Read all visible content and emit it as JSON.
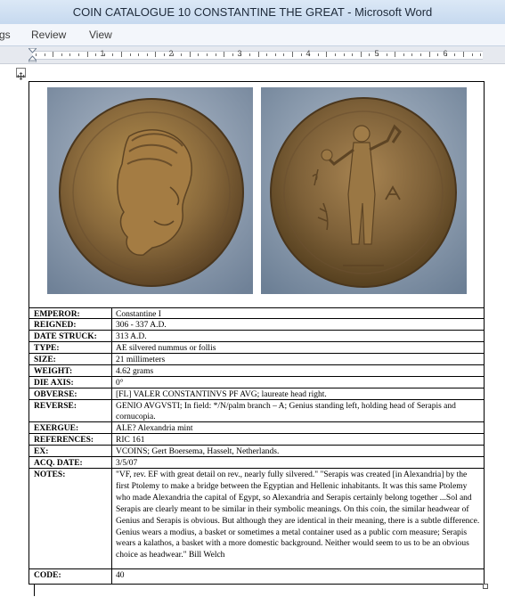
{
  "window": {
    "title": "COIN CATALOGUE 10 CONSTANTINE THE GREAT  -  Microsoft Word"
  },
  "ribbon": {
    "tabs": [
      "gs",
      "Review",
      "View"
    ]
  },
  "ruler": {
    "numbers": [
      "1",
      "2",
      "3",
      "4",
      "5",
      "6"
    ]
  },
  "table": {
    "rows": [
      {
        "label": "EMPEROR:",
        "value": "Constantine I"
      },
      {
        "label": "REIGNED:",
        "value": "306 - 337 A.D."
      },
      {
        "label": "DATE STRUCK:",
        "value": "313 A.D."
      },
      {
        "label": "TYPE:",
        "value": "AE silvered nummus or follis"
      },
      {
        "label": "SIZE:",
        "value": "21 millimeters"
      },
      {
        "label": "WEIGHT:",
        "value": "4.62 grams"
      },
      {
        "label": "DIE AXIS:",
        "value": "0°"
      },
      {
        "label": "OBVERSE:",
        "value": "[FL] VALER CONSTANTINVS PF AVG; laureate head right."
      },
      {
        "label": "REVERSE:",
        "value": "GENIO AVGVSTI; In field: */N/palm branch – A; Genius standing left, holding head of Serapis and cornucopia."
      },
      {
        "label": "EXERGUE:",
        "value": "ALE? Alexandria mint"
      },
      {
        "label": "REFERENCES:",
        "value": "RIC 161"
      },
      {
        "label": "EX:",
        "value": "VCOINS; Gert Boersema, Hasselt, Netherlands."
      },
      {
        "label": "ACQ. DATE:",
        "value": "3/5/07"
      },
      {
        "label": "NOTES:",
        "value": "\"VF, rev. EF with great detail on rev., nearly fully silvered.\"  \"Serapis was created [in Alexandria] by the first Ptolemy to make a bridge between the Egyptian and Hellenic inhabitants. It was this same Ptolemy who made Alexandria the capital of Egypt, so Alexandria and Serapis certainly belong together ...Sol and Serapis are clearly meant to be similar in their symbolic meanings. On this coin, the similar headwear of Genius and Serapis is obvious. But although they are identical in their meaning, there is a subtle difference. Genius wears a modius, a basket or sometimes a metal container used as a public corn measure; Serapis wears a kalathos, a basket with a more domestic background. Neither would seem to us to be an obvious choice as headwear.\" Bill Welch"
      },
      {
        "label": "CODE:",
        "value": "40"
      }
    ]
  },
  "colors": {
    "titlebar": "#c6d9ef",
    "coin_bronze": "#8a6a3c",
    "photo_background": "#8f9fb2"
  }
}
